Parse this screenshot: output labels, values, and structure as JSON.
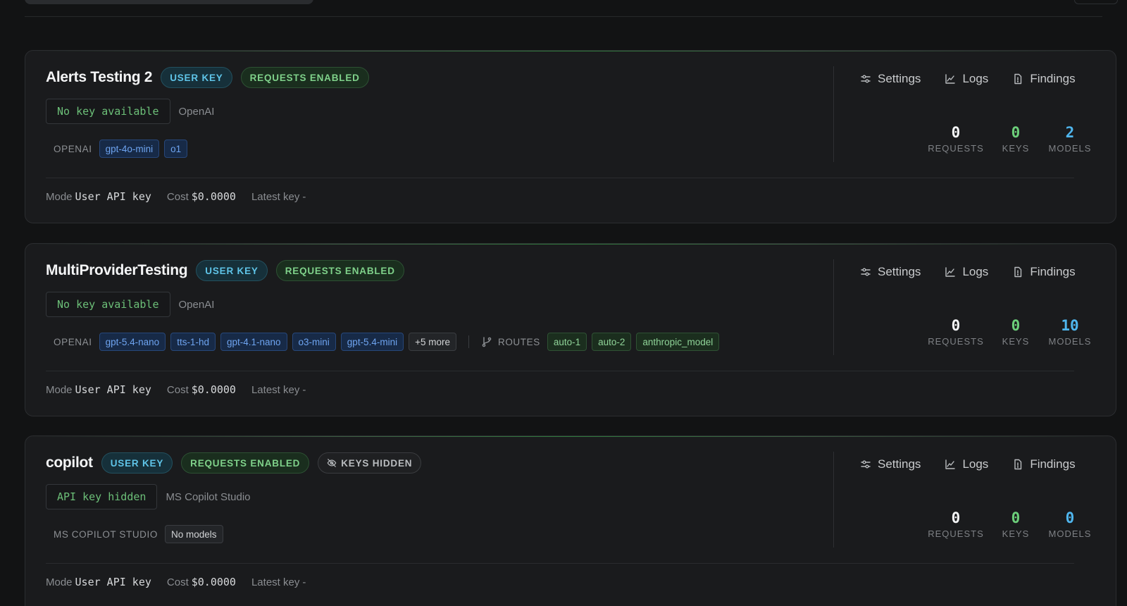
{
  "action_labels": {
    "settings": "Settings",
    "logs": "Logs",
    "findings": "Findings"
  },
  "stat_labels": {
    "requests": "REQUESTS",
    "keys": "KEYS",
    "models": "MODELS"
  },
  "footer_labels": {
    "mode": "Mode",
    "cost": "Cost",
    "latest": "Latest key"
  },
  "routes_label": "ROUTES",
  "colors": {
    "user_key": "#5fc4e8",
    "requests_enabled": "#7fd18a",
    "model_chip": "#6ea4f0",
    "keys_stat": "#6ccf7a",
    "models_stat": "#4fb6ee"
  },
  "projects": [
    {
      "name": "Alerts Testing 2",
      "badges": {
        "user_key": "USER KEY",
        "requests": "REQUESTS ENABLED"
      },
      "key_display": "No key available",
      "provider": "OpenAI",
      "provider_label": "OPENAI",
      "models": [
        "gpt-4o-mini",
        "o1"
      ],
      "stats": {
        "requests": "0",
        "keys": "0",
        "models": "2"
      },
      "footer": {
        "mode": "User API key",
        "cost": "$0.0000",
        "latest": "-"
      }
    },
    {
      "name": "MultiProviderTesting",
      "badges": {
        "user_key": "USER KEY",
        "requests": "REQUESTS ENABLED"
      },
      "key_display": "No key available",
      "provider": "OpenAI",
      "provider_label": "OPENAI",
      "models": [
        "gpt-5.4-nano",
        "tts-1-hd",
        "gpt-4.1-nano",
        "o3-mini",
        "gpt-5.4-mini"
      ],
      "more": "+5 more",
      "routes": [
        "auto-1",
        "auto-2",
        "anthropic_model"
      ],
      "stats": {
        "requests": "0",
        "keys": "0",
        "models": "10"
      },
      "footer": {
        "mode": "User API key",
        "cost": "$0.0000",
        "latest": "-"
      }
    },
    {
      "name": "copilot",
      "badges": {
        "user_key": "USER KEY",
        "requests": "REQUESTS ENABLED",
        "keys_hidden": "KEYS HIDDEN"
      },
      "key_display": "API key hidden",
      "provider": "MS Copilot Studio",
      "provider_label": "MS COPILOT STUDIO",
      "no_models": "No models",
      "stats": {
        "requests": "0",
        "keys": "0",
        "models": "0"
      },
      "footer": {
        "mode": "User API key",
        "cost": "$0.0000",
        "latest": "-"
      }
    }
  ]
}
